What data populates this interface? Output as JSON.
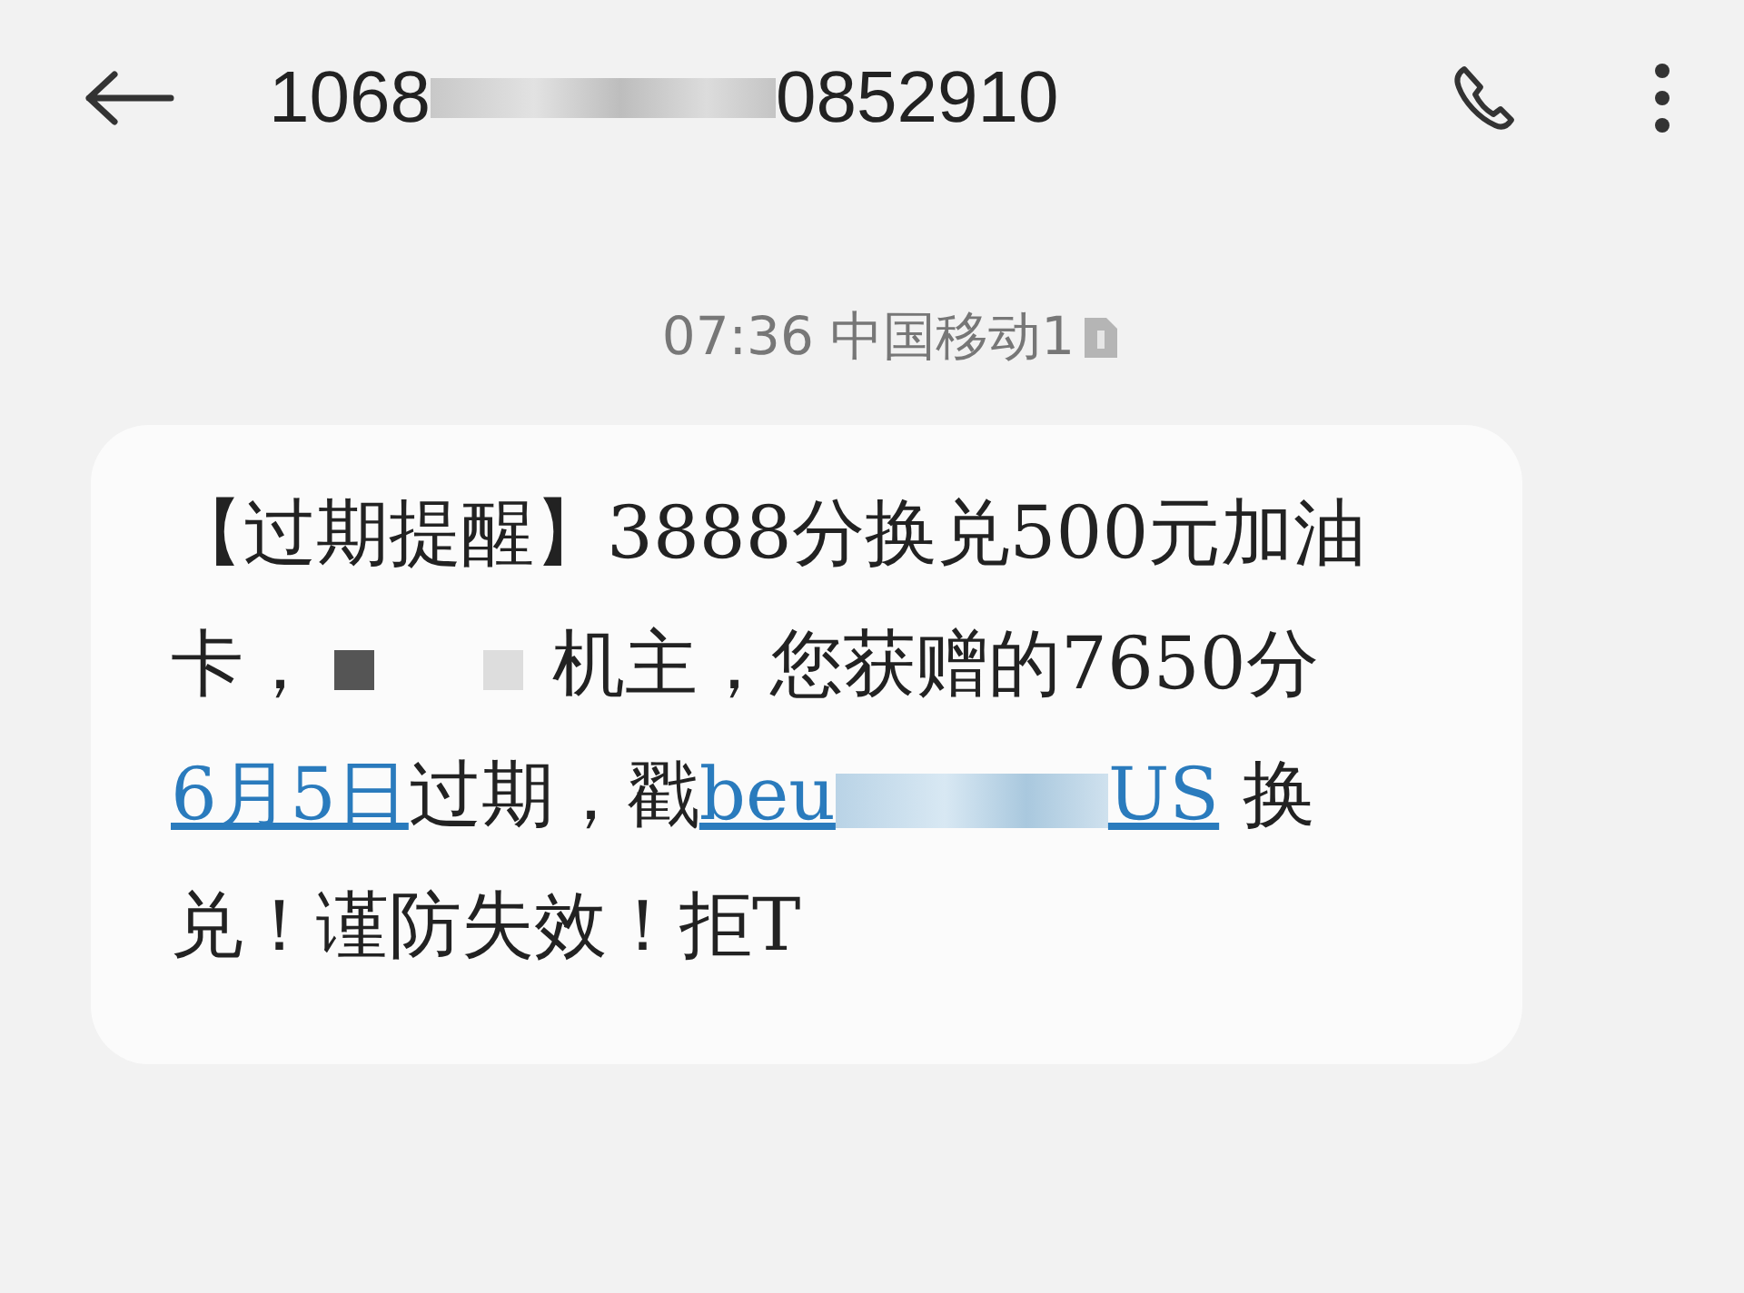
{
  "header": {
    "number_parts": [
      "1068",
      "0852910"
    ]
  },
  "timestamp": {
    "time": "07:36",
    "carrier": "中国移动1"
  },
  "message": {
    "segments": [
      {
        "kind": "text",
        "text": "【过期提醒】3888分换兑500元加油卡，"
      },
      {
        "kind": "redacted"
      },
      {
        "kind": "text",
        "text": "机主，您获赠的7650分"
      },
      {
        "kind": "link",
        "parts": [
          "6月5日"
        ]
      },
      {
        "kind": "text",
        "text": "过期，戳"
      },
      {
        "kind": "link",
        "parts": [
          "beu",
          "US"
        ]
      },
      {
        "kind": "text",
        "text": " 换兑！谨防失效！拒T"
      }
    ]
  }
}
